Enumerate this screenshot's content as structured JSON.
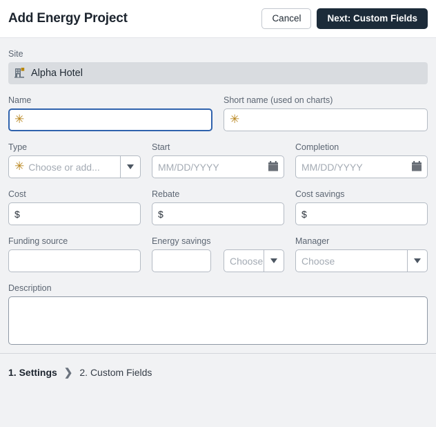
{
  "header": {
    "title": "Add Energy Project",
    "cancel_label": "Cancel",
    "next_label": "Next: Custom Fields"
  },
  "colors": {
    "primary_button_bg": "#1c2b39",
    "focus_border": "#2f62ad",
    "required_marker": "#b9861f",
    "page_bg": "#f1f2f4",
    "site_banner_bg": "#d9dce0",
    "site_icon_accent": "#b8860b"
  },
  "form": {
    "site": {
      "label": "Site",
      "value": "Alpha Hotel",
      "icon": "building-icon"
    },
    "name": {
      "label": "Name",
      "value": "",
      "required_marker": "✳",
      "focused": true
    },
    "short_name": {
      "label": "Short name (used on charts)",
      "value": "",
      "required_marker": "✳"
    },
    "type": {
      "label": "Type",
      "placeholder": "Choose or add...",
      "value": "",
      "required_marker": "✳"
    },
    "start": {
      "label": "Start",
      "placeholder": "MM/DD/YYYY",
      "value": "",
      "icon": "calendar-icon"
    },
    "completion": {
      "label": "Completion",
      "placeholder": "MM/DD/YYYY",
      "value": "",
      "icon": "calendar-icon"
    },
    "cost": {
      "label": "Cost",
      "prefix": "$",
      "value": ""
    },
    "rebate": {
      "label": "Rebate",
      "prefix": "$",
      "value": ""
    },
    "cost_savings": {
      "label": "Cost savings",
      "prefix": "$",
      "value": ""
    },
    "funding_source": {
      "label": "Funding source",
      "value": ""
    },
    "energy_savings": {
      "label": "Energy savings",
      "value": "",
      "units_placeholder": "Choose"
    },
    "manager": {
      "label": "Manager",
      "placeholder": "Choose",
      "value": ""
    },
    "description": {
      "label": "Description",
      "value": ""
    }
  },
  "footer": {
    "step_current": "1. Settings",
    "separator": "❯",
    "step_next": "2. Custom Fields"
  }
}
